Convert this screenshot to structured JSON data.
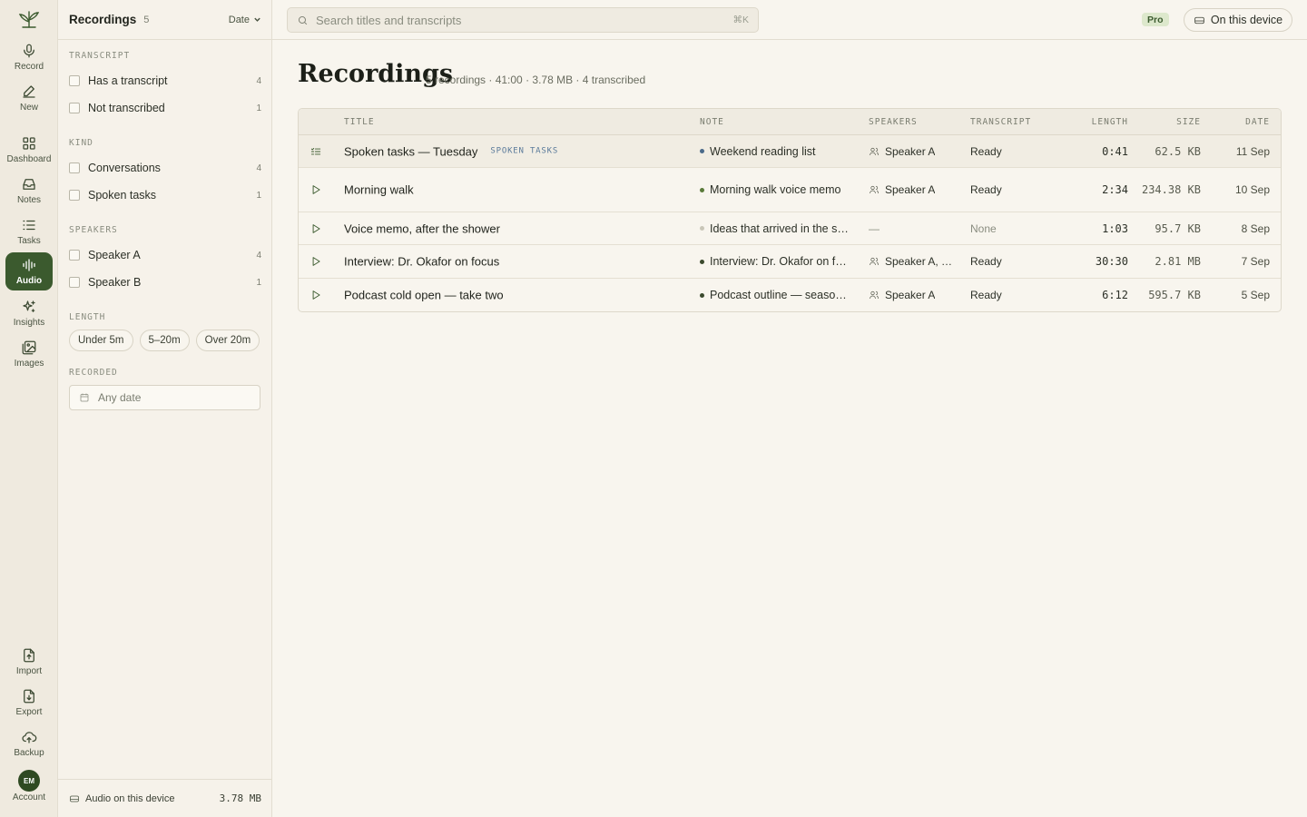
{
  "rail": {
    "logo": "leaf-logo",
    "items": [
      {
        "label": "Record",
        "icon": "mic-icon"
      },
      {
        "label": "New",
        "icon": "pencil-icon"
      },
      {
        "label": "Dashboard",
        "icon": "grid-icon"
      },
      {
        "label": "Notes",
        "icon": "inbox-icon"
      },
      {
        "label": "Tasks",
        "icon": "list-icon"
      },
      {
        "label": "Audio",
        "icon": "waveform-icon",
        "active": true
      },
      {
        "label": "Insights",
        "icon": "sparkles-icon"
      },
      {
        "label": "Images",
        "icon": "images-icon"
      }
    ],
    "bottom": [
      {
        "label": "Import",
        "icon": "file-upload-icon"
      },
      {
        "label": "Export",
        "icon": "file-download-icon"
      },
      {
        "label": "Backup",
        "icon": "cloud-upload-icon"
      }
    ],
    "account": {
      "initials": "EM",
      "label": "Account"
    }
  },
  "filters": {
    "title": "Recordings",
    "count": "5",
    "sort_label": "Date",
    "transcript": {
      "label": "TRANSCRIPT",
      "options": [
        {
          "label": "Has a transcript",
          "count": "4"
        },
        {
          "label": "Not transcribed",
          "count": "1"
        }
      ]
    },
    "kind": {
      "label": "KIND",
      "options": [
        {
          "label": "Conversations",
          "count": "4"
        },
        {
          "label": "Spoken tasks",
          "count": "1"
        }
      ]
    },
    "speakers": {
      "label": "SPEAKERS",
      "options": [
        {
          "label": "Speaker A",
          "count": "4"
        },
        {
          "label": "Speaker B",
          "count": "1"
        }
      ]
    },
    "length": {
      "label": "LENGTH",
      "chips": [
        "Under 5m",
        "5–20m",
        "Over 20m"
      ]
    },
    "recorded": {
      "label": "RECORDED",
      "placeholder": "Any date"
    },
    "footer": {
      "label": "Audio on this device",
      "size": "3.78 MB"
    }
  },
  "topbar": {
    "search_placeholder": "Search titles and transcripts",
    "shortcut": "⌘K",
    "badge": "Pro",
    "device_label": "On this device"
  },
  "main": {
    "title": "Recordings",
    "subtitle": "5 recordings · 41:00 · 3.78 MB · 4 transcribed",
    "columns": [
      "TITLE",
      "NOTE",
      "SPEAKERS",
      "TRANSCRIPT",
      "LENGTH",
      "SIZE",
      "DATE"
    ],
    "rows": [
      {
        "icon": "tasks-icon",
        "title": "Spoken tasks — Tuesday",
        "tag": "SPOKEN TASKS",
        "note": "Weekend reading list",
        "note_color": "#4a6a8a",
        "speakers": "Speaker A",
        "transcript": "Ready",
        "length": "0:41",
        "size": "62.5 KB",
        "date": "11 Sep",
        "selected": true
      },
      {
        "icon": "play-icon",
        "title": "Morning walk",
        "tag": "",
        "note": "Morning walk voice memo",
        "note_color": "#5a7a3a",
        "speakers": "Speaker A",
        "transcript": "Ready",
        "length": "2:34",
        "size": "234.38 KB",
        "date": "10 Sep"
      },
      {
        "icon": "play-icon",
        "title": "Voice memo, after the shower",
        "tag": "",
        "note": "Ideas that arrived in the s…",
        "note_color": "#c9c6b8",
        "speakers": "—",
        "transcript": "None",
        "length": "1:03",
        "size": "95.7 KB",
        "date": "8 Sep"
      },
      {
        "icon": "play-icon",
        "title": "Interview: Dr. Okafor on focus",
        "tag": "",
        "note": "Interview: Dr. Okafor on f…",
        "note_color": "#3b4a2e",
        "speakers": "Speaker A, S…",
        "transcript": "Ready",
        "length": "30:30",
        "size": "2.81 MB",
        "date": "7 Sep"
      },
      {
        "icon": "play-icon",
        "title": "Podcast cold open — take two",
        "tag": "",
        "note": "Podcast outline — seaso…",
        "note_color": "#3b4a2e",
        "speakers": "Speaker A",
        "transcript": "Ready",
        "length": "6:12",
        "size": "595.7 KB",
        "date": "5 Sep"
      }
    ]
  },
  "colors": {
    "accent": "#3b5a2e",
    "background": "#f8f5ee",
    "sidebar": "#efeadf"
  }
}
